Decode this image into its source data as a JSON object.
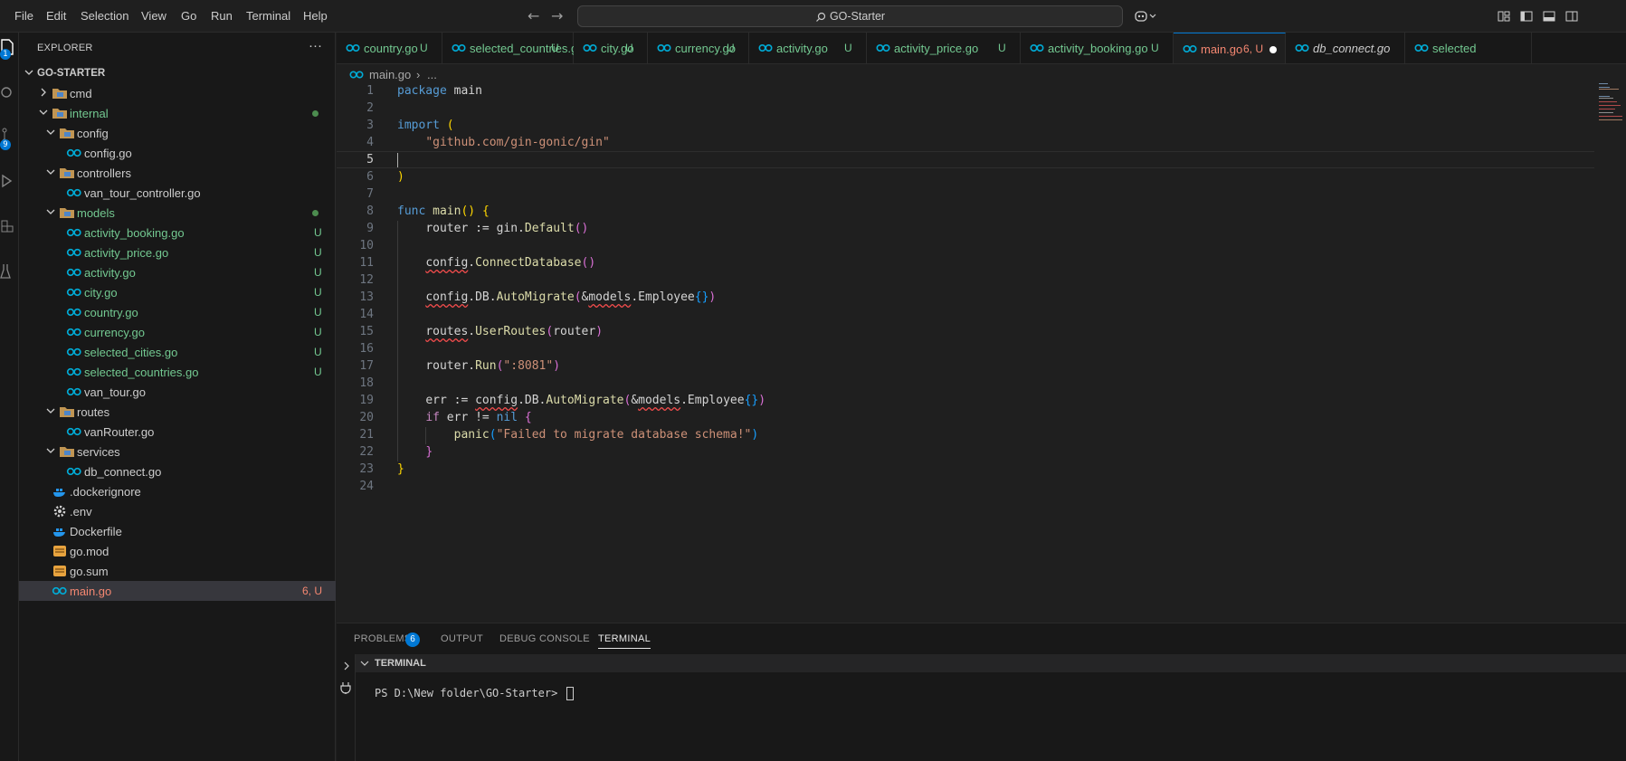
{
  "menu": [
    "File",
    "Edit",
    "Selection",
    "View",
    "Go",
    "Run",
    "Terminal",
    "Help"
  ],
  "search": {
    "text": "GO-Starter"
  },
  "activity_bar": {
    "explorer_badge": "1",
    "scm_badge": "9"
  },
  "sidebar": {
    "title": "EXPLORER",
    "more": "···",
    "root": "GO-STARTER",
    "items": [
      {
        "name": "cmd",
        "type": "folder",
        "status": "",
        "color": "#cccccc"
      },
      {
        "name": "internal",
        "type": "folder",
        "status": "",
        "color": "#73c991"
      },
      {
        "name": "config",
        "type": "folder",
        "status": "",
        "color": "#cccccc"
      },
      {
        "name": "config.go",
        "type": "go",
        "status": "",
        "color": "#cccccc"
      },
      {
        "name": "controllers",
        "type": "folder",
        "status": "",
        "color": "#cccccc"
      },
      {
        "name": "van_tour_controller.go",
        "type": "go",
        "status": "",
        "color": "#cccccc"
      },
      {
        "name": "models",
        "type": "folder",
        "status": "",
        "color": "#73c991"
      },
      {
        "name": "activity_booking.go",
        "type": "go",
        "status": "U",
        "color": "#73c991"
      },
      {
        "name": "activity_price.go",
        "type": "go",
        "status": "U",
        "color": "#73c991"
      },
      {
        "name": "activity.go",
        "type": "go",
        "status": "U",
        "color": "#73c991"
      },
      {
        "name": "city.go",
        "type": "go",
        "status": "U",
        "color": "#73c991"
      },
      {
        "name": "country.go",
        "type": "go",
        "status": "U",
        "color": "#73c991"
      },
      {
        "name": "currency.go",
        "type": "go",
        "status": "U",
        "color": "#73c991"
      },
      {
        "name": "selected_cities.go",
        "type": "go",
        "status": "U",
        "color": "#73c991"
      },
      {
        "name": "selected_countries.go",
        "type": "go",
        "status": "U",
        "color": "#73c991"
      },
      {
        "name": "van_tour.go",
        "type": "go",
        "status": "",
        "color": "#cccccc"
      },
      {
        "name": "routes",
        "type": "folder",
        "status": "",
        "color": "#cccccc"
      },
      {
        "name": "vanRouter.go",
        "type": "go",
        "status": "",
        "color": "#cccccc"
      },
      {
        "name": "services",
        "type": "folder",
        "status": "",
        "color": "#cccccc"
      },
      {
        "name": "db_connect.go",
        "type": "go",
        "status": "",
        "color": "#cccccc"
      },
      {
        "name": ".dockerignore",
        "type": "docker",
        "status": "",
        "color": "#cccccc"
      },
      {
        "name": ".env",
        "type": "gear",
        "status": "",
        "color": "#cccccc"
      },
      {
        "name": "Dockerfile",
        "type": "docker",
        "status": "",
        "color": "#cccccc"
      },
      {
        "name": "go.mod",
        "type": "mod",
        "status": "",
        "color": "#cccccc"
      },
      {
        "name": "go.sum",
        "type": "mod",
        "status": "",
        "color": "#cccccc"
      },
      {
        "name": "main.go",
        "type": "go",
        "status": "6, U",
        "color": "#f48771"
      }
    ]
  },
  "tabs": [
    {
      "label": "country.go",
      "status": "U",
      "color": "#73c991"
    },
    {
      "label": "selected_countries.go",
      "status": "U",
      "color": "#73c991"
    },
    {
      "label": "city.go",
      "status": "U",
      "color": "#73c991"
    },
    {
      "label": "currency.go",
      "status": "U",
      "color": "#73c991"
    },
    {
      "label": "activity.go",
      "status": "U",
      "color": "#73c991"
    },
    {
      "label": "activity_price.go",
      "status": "U",
      "color": "#73c991"
    },
    {
      "label": "activity_booking.go",
      "status": "U",
      "color": "#73c991"
    },
    {
      "label": "main.go",
      "status": "6, U",
      "color": "#f48771"
    },
    {
      "label": "db_connect.go",
      "status": "",
      "color": "#cccccc"
    },
    {
      "label": "selected",
      "status": "",
      "color": "#73c991"
    }
  ],
  "breadcrumb": {
    "file": "main.go",
    "sep": "›",
    "rest": "..."
  },
  "code": {
    "line_numbers": [
      "1",
      "2",
      "3",
      "4",
      "5",
      "6",
      "7",
      "8",
      "9",
      "10",
      "11",
      "12",
      "13",
      "14",
      "15",
      "16",
      "17",
      "18",
      "19",
      "20",
      "21",
      "22",
      "23",
      "24"
    ],
    "l1_kw": "package",
    "l1_name": "main",
    "l3_kw": "import",
    "l3_paren": "(",
    "l4_str": "\"github.com/gin-gonic/gin\"",
    "l6_paren": ")",
    "l8_kw": "func",
    "l8_fn": "main",
    "l8_parens": "()",
    "l8_brace": "{",
    "l9_a": "router := gin.",
    "l9_fn": "Default",
    "l9_parens": "()",
    "l11_a": "config",
    "l11_b": ".",
    "l11_fn": "ConnectDatabase",
    "l11_parens": "()",
    "l13_a": "config",
    "l13_b": ".DB.",
    "l13_fn": "AutoMigrate",
    "l13_p1": "(",
    "l13_c": "&",
    "l13_d": "models",
    "l13_e": ".Employee",
    "l13_braces": "{}",
    "l13_p2": ")",
    "l15_a": "routes",
    "l15_b": ".",
    "l15_fn": "UserRoutes",
    "l15_p1": "(",
    "l15_c": "router",
    "l15_p2": ")",
    "l17_a": "router.",
    "l17_fn": "Run",
    "l17_p1": "(",
    "l17_str": "\":8081\"",
    "l17_p2": ")",
    "l19_a": "err := ",
    "l19_b": "config",
    "l19_c": ".DB.",
    "l19_fn": "AutoMigrate",
    "l19_p1": "(",
    "l19_d": "&",
    "l19_e": "models",
    "l19_f": ".Employee",
    "l19_braces": "{}",
    "l19_p2": ")",
    "l20_kw": "if",
    "l20_a": " err != ",
    "l20_nil": "nil",
    "l20_brace": "{",
    "l21_fn": "panic",
    "l21_p1": "(",
    "l21_str": "\"Failed to migrate database schema!\"",
    "l21_p2": ")",
    "l22_brace": "}",
    "l23_brace": "}"
  },
  "panel": {
    "tabs": [
      "PROBLEMS",
      "OUTPUT",
      "DEBUG CONSOLE",
      "TERMINAL"
    ],
    "problems_count": "6",
    "terminal_title": "TERMINAL",
    "prompt": "PS D:\\New folder\\GO-Starter> "
  },
  "colors": {
    "accent": "#0078d4",
    "untracked": "#73c991",
    "error": "#f48771"
  }
}
